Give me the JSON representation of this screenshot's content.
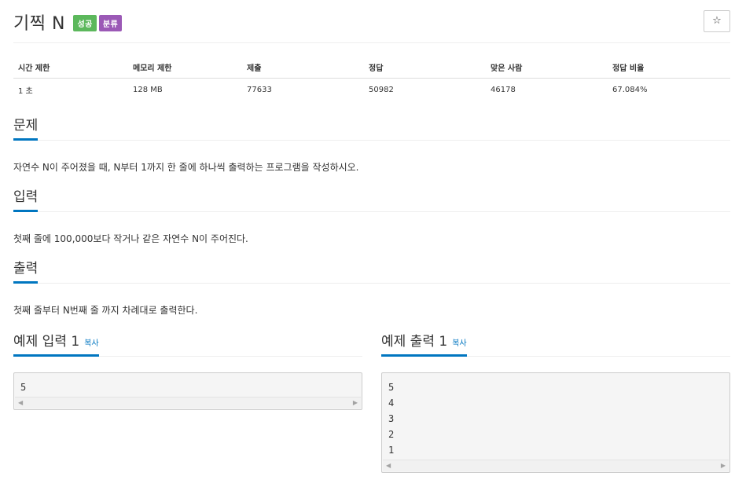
{
  "problem": {
    "title": "기찍 N",
    "labels": {
      "success": "성공",
      "tag": "분류"
    },
    "star_icon": "☆"
  },
  "info_table": {
    "headers": [
      "시간 제한",
      "메모리 제한",
      "제출",
      "정답",
      "맞은 사람",
      "정답 비율"
    ],
    "values": [
      "1 초",
      "128 MB",
      "77633",
      "50982",
      "46178",
      "67.084%"
    ]
  },
  "sections": {
    "description": {
      "title": "문제",
      "text": "자연수 N이 주어졌을 때, N부터 1까지 한 줄에 하나씩 출력하는 프로그램을 작성하시오."
    },
    "input": {
      "title": "입력",
      "text": "첫째 줄에 100,000보다 작거나 같은 자연수 N이 주어진다."
    },
    "output": {
      "title": "출력",
      "text": "첫째 줄부터 N번째 줄 까지 차례대로 출력한다."
    }
  },
  "samples": {
    "copy_label": "복사",
    "input": {
      "title": "예제 입력 1",
      "lines": [
        "5"
      ]
    },
    "output": {
      "title": "예제 출력 1",
      "lines": [
        "5",
        "4",
        "3",
        "2",
        "1"
      ]
    }
  },
  "scroll_icons": {
    "left": "◀",
    "right": "▶"
  },
  "colors": {
    "accent": "#0076c0",
    "success": "#5cb85c",
    "tag": "#9b59b6"
  }
}
